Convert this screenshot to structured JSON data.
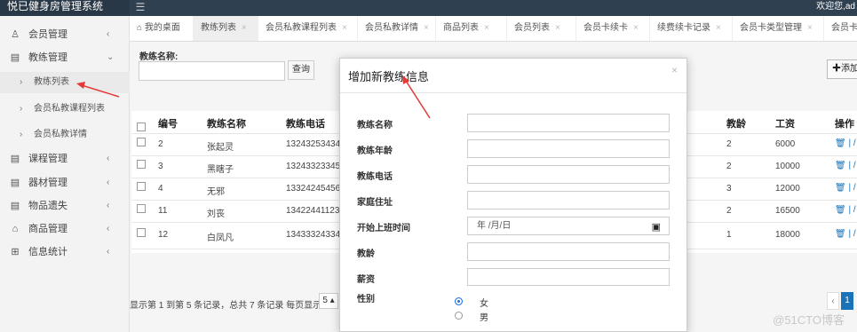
{
  "app": {
    "title": "悦已健身房管理系统",
    "welcome": "欢迎您,ad"
  },
  "sidebar": {
    "items": [
      {
        "icon": "user-icon",
        "label": "会员管理"
      },
      {
        "icon": "file-icon",
        "label": "教练管理"
      },
      {
        "icon": "file-icon",
        "label": "课程管理"
      },
      {
        "icon": "file-icon",
        "label": "器材管理"
      },
      {
        "icon": "file-icon",
        "label": "物品遗失"
      },
      {
        "icon": "cart-icon",
        "label": "商品管理"
      },
      {
        "icon": "grid-icon",
        "label": "信息统计"
      }
    ],
    "sub_items": [
      {
        "label": "教练列表"
      },
      {
        "label": "会员私教课程列表"
      },
      {
        "label": "会员私教详情"
      }
    ]
  },
  "tabs": [
    {
      "label": "我的桌面"
    },
    {
      "label": "教练列表"
    },
    {
      "label": "会员私教课程列表"
    },
    {
      "label": "会员私教详情"
    },
    {
      "label": "商品列表"
    },
    {
      "label": "会员列表"
    },
    {
      "label": "会员卡续卡"
    },
    {
      "label": "续费续卡记录"
    },
    {
      "label": "会员卡类型管理"
    },
    {
      "label": "会员卡"
    }
  ],
  "search": {
    "label": "教练名称:",
    "query_label": "查询",
    "add_label": "✚添加"
  },
  "table": {
    "headers": [
      "编号",
      "教练名称",
      "教练电话",
      "教龄",
      "工资",
      "操作"
    ],
    "rows": [
      {
        "id": "2",
        "name": "张起灵",
        "phone": "13243253434",
        "years": "2",
        "salary": "6000",
        "op": "🗑 | /"
      },
      {
        "id": "3",
        "name": "黑瞎子",
        "phone": "13243323345",
        "years": "2",
        "salary": "10000",
        "op": "🗑 | /"
      },
      {
        "id": "4",
        "name": "无邪",
        "phone": "13324245456",
        "years": "3",
        "salary": "12000",
        "op": "🗑 | /"
      },
      {
        "id": "11",
        "name": "刘丧",
        "phone": "13422441123",
        "years": "2",
        "salary": "16500",
        "op": "🗑 | /"
      },
      {
        "id": "12",
        "name": "白凤凡",
        "phone": "13433324334",
        "years": "1",
        "salary": "18000",
        "op": "🗑 | /"
      }
    ],
    "pager_info": "显示第 1 到第 5 条记录，总共 7 条记录 每页显示",
    "page_size": "5 ▴",
    "prev": "‹",
    "current_page": "1"
  },
  "modal": {
    "title": "增加新教练信息",
    "fields": [
      {
        "label": "教练名称",
        "value": ""
      },
      {
        "label": "教练年龄",
        "value": ""
      },
      {
        "label": "教练电话",
        "value": ""
      },
      {
        "label": "家庭住址",
        "value": ""
      },
      {
        "label": "开始上班时间",
        "value": "年 /月/日"
      },
      {
        "label": "教龄",
        "value": ""
      },
      {
        "label": "薪资",
        "value": ""
      }
    ],
    "gender_label": "性别",
    "gender_options": [
      {
        "label": "女",
        "checked": true
      },
      {
        "label": "男",
        "checked": false
      }
    ]
  },
  "watermark": "@51CTO博客",
  "colors": {
    "sidebar_header": "#293846",
    "topbar": "#2f4050",
    "annotation_arrow": "#e53935",
    "action_blue": "#1a73b8"
  }
}
